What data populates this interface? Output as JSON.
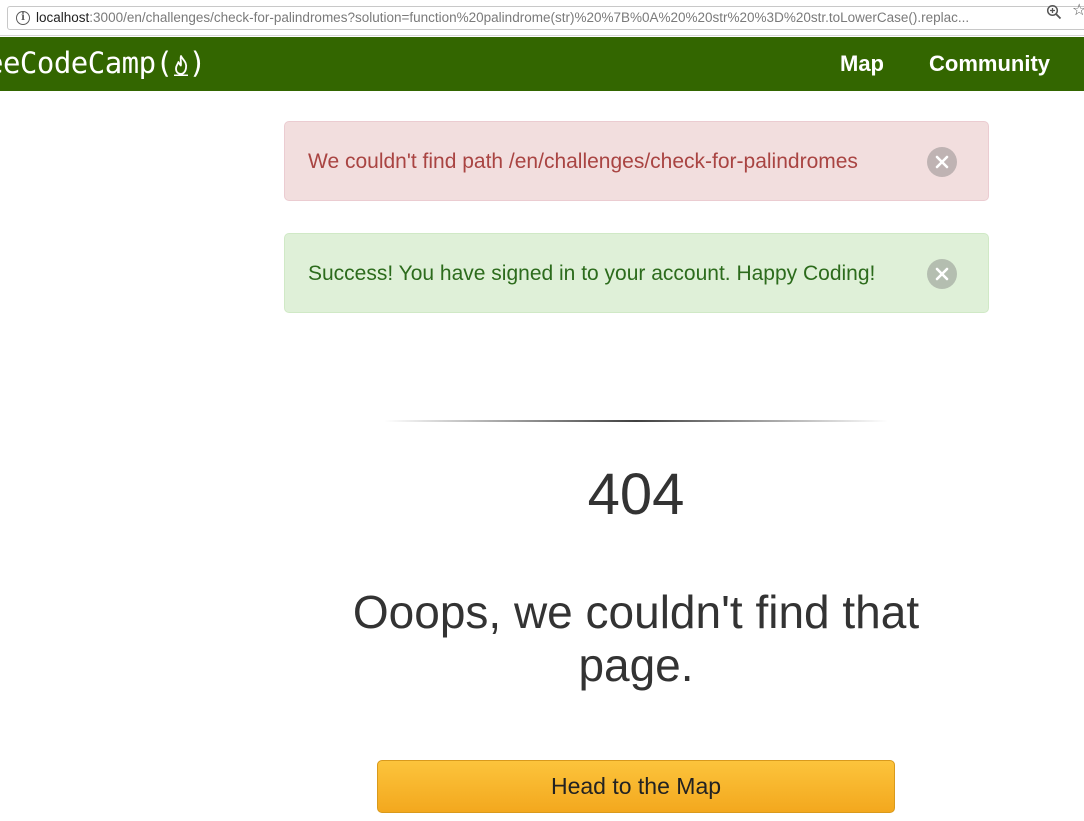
{
  "browser": {
    "url_host": "localhost",
    "url_rest": ":3000/en/challenges/check-for-palindromes?solution=function%20palindrome(str)%20%7B%0A%20%20str%20%3D%20str.toLowerCase().replac...",
    "icons": [
      "info-icon",
      "zoom-icon",
      "star-icon"
    ]
  },
  "navbar": {
    "brand": "eeCodeCamp(",
    "brand_close": ")",
    "links": {
      "map": "Map",
      "community": "Community"
    },
    "color": "#336600"
  },
  "alerts": {
    "danger": {
      "text": "We couldn't find path /en/challenges/check-for-palindromes",
      "color": "#a94442",
      "background": "#f2dede"
    },
    "success": {
      "text": "Success! You have signed in to your account. Happy Coding!",
      "color": "#2c6b1c",
      "background": "#dff0d8"
    }
  },
  "not_found": {
    "code": "404",
    "message": "Ooops, we couldn't find that page.",
    "button_label": "Head to the Map",
    "button_color": "#f5b52a"
  }
}
